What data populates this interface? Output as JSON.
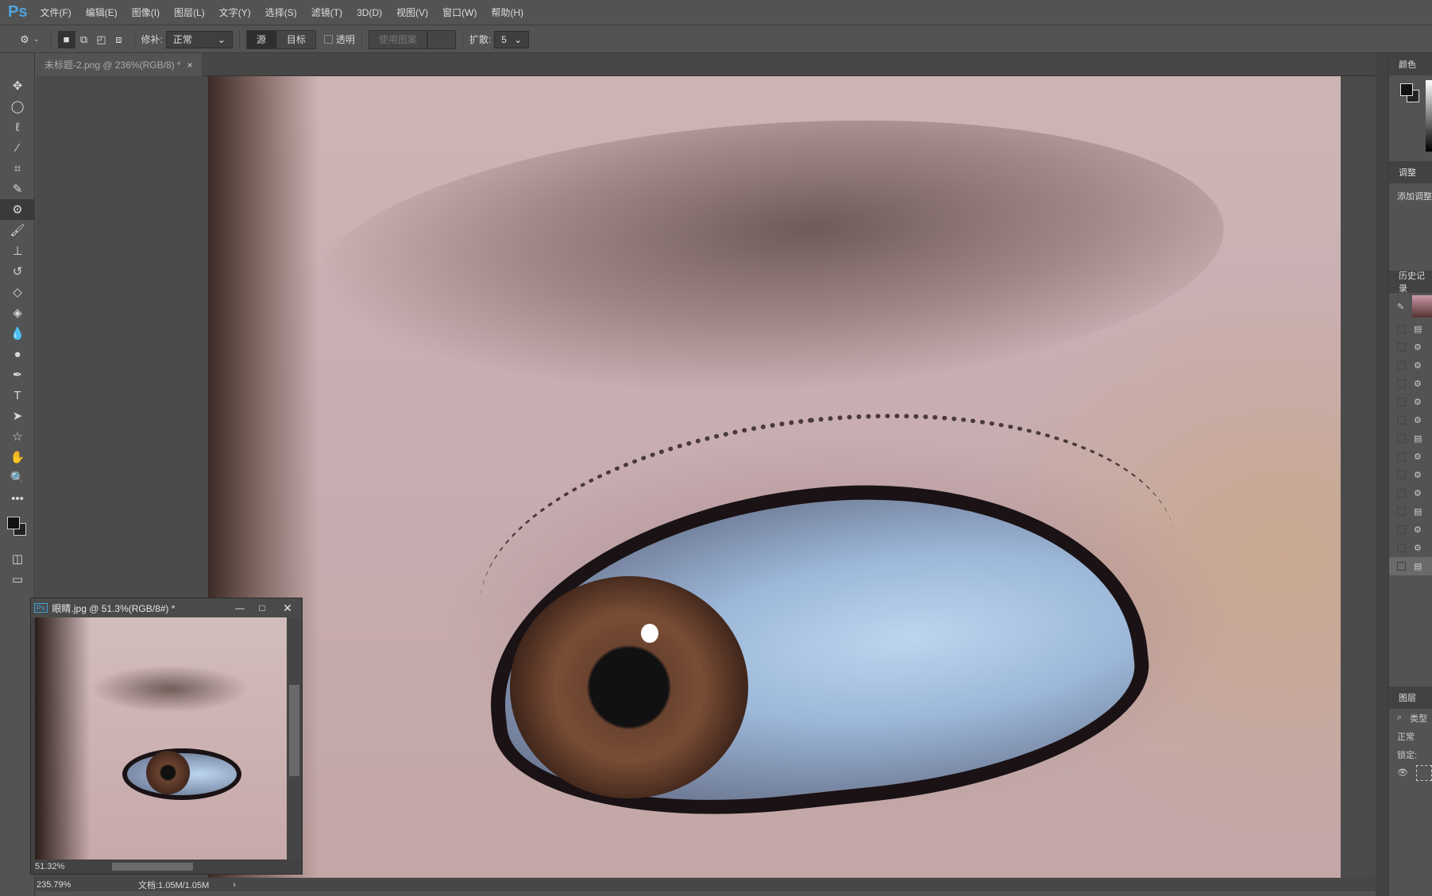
{
  "app": {
    "logo": "Ps"
  },
  "menu": [
    "文件(F)",
    "编辑(E)",
    "图像(I)",
    "图层(L)",
    "文字(Y)",
    "选择(S)",
    "滤镜(T)",
    "3D(D)",
    "视图(V)",
    "窗口(W)",
    "帮助(H)"
  ],
  "options": {
    "patch_label": "修补:",
    "patch_value": "正常",
    "source": "源",
    "target": "目标",
    "transparent": "透明",
    "use_pattern": "使用图案",
    "diffuse_label": "扩散:",
    "diffuse_value": "5"
  },
  "document_tab": {
    "title": "未标题-2.png @ 236%(RGB/8) *",
    "close": "×"
  },
  "tools": [
    "move-icon",
    "ellipse-marquee-icon",
    "lasso-icon",
    "magic-wand-icon",
    "crop-icon",
    "eyedropper-icon",
    "patch-icon",
    "brush-icon",
    "stamp-icon",
    "history-brush-icon",
    "eraser-icon",
    "paint-bucket-icon",
    "blur-icon",
    "dodge-icon",
    "pen-icon",
    "type-icon",
    "path-select-icon",
    "shape-icon",
    "hand-icon",
    "zoom-icon",
    "more-icon"
  ],
  "right_panel": {
    "color_tab": "颜色",
    "adjust_tab": "调整",
    "adjust_add": "添加调整",
    "history_tab": "历史记录",
    "history_items": [
      "doc",
      "patch",
      "patch",
      "patch",
      "patch",
      "patch",
      "doc",
      "patch",
      "patch",
      "patch",
      "doc",
      "patch",
      "patch",
      "doc"
    ],
    "layers_tab": "图层",
    "layers_search": "类型",
    "blend_mode": "正常",
    "lock_label": "锁定:"
  },
  "floating_window": {
    "title": "眼睛.jpg @ 51.3%(RGB/8#) *",
    "zoom": "51.32%"
  },
  "status": {
    "zoom": "235.79%",
    "doc": "文档:1.05M/1.05M"
  }
}
